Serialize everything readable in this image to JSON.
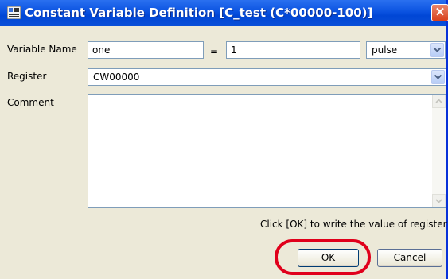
{
  "window": {
    "title": "Constant Variable Definition [C_test (C*00000-100)]",
    "close_glyph": "✕"
  },
  "form": {
    "variable_name_label": "Variable Name",
    "variable_name_value": "one",
    "equals": "=",
    "value": "1",
    "unit": "pulse",
    "register_label": "Register",
    "register_value": "CW00000",
    "comment_label": "Comment",
    "comment_value": ""
  },
  "note": "Click [OK] to write the value of register C.",
  "buttons": {
    "ok": "OK",
    "cancel": "Cancel"
  },
  "colors": {
    "titlebar": "#0a52e0",
    "highlight": "#e0001b",
    "field_border": "#7f9db9"
  },
  "icons": [
    "app-icon",
    "close-icon",
    "chevron-down-icon",
    "scroll-up-icon",
    "scroll-down-icon"
  ]
}
